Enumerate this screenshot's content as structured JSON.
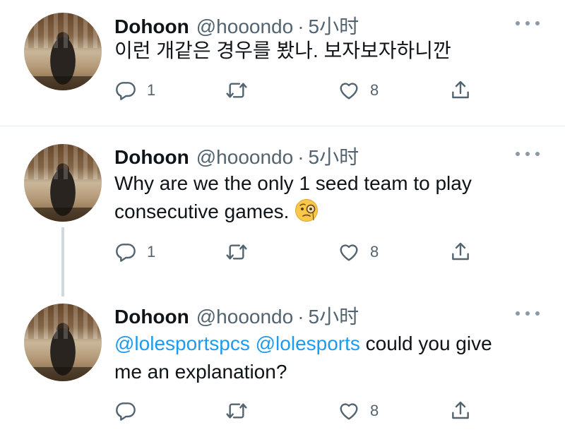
{
  "tweets": [
    {
      "name": "Dohoon",
      "handle": "@hooondo",
      "separator": "·",
      "time": "5小时",
      "text": "이런 개같은 경우를 봤나. 보자보자하니깐",
      "reply_count": "1",
      "retweet_count": "",
      "like_count": "8"
    },
    {
      "name": "Dohoon",
      "handle": "@hooondo",
      "separator": "·",
      "time": "5小时",
      "text_line1": "Why are we the only 1 seed team to play",
      "text_line2": "consecutive games.",
      "emoji": "face-with-monocle",
      "reply_count": "1",
      "retweet_count": "",
      "like_count": "8"
    },
    {
      "name": "Dohoon",
      "handle": "@hooondo",
      "separator": "·",
      "time": "5小时",
      "mention1": "@lolesportspcs",
      "mention2": "@lolesports",
      "text_rest": " could you give",
      "text_line2": "me an explanation?",
      "reply_count": "",
      "retweet_count": "",
      "like_count": "8"
    }
  ],
  "icons": [
    "reply-icon",
    "retweet-icon",
    "like-icon",
    "share-icon",
    "more-icon"
  ],
  "colors": {
    "text": "#0f1419",
    "secondary": "#536471",
    "mention": "#1d9bf0"
  }
}
